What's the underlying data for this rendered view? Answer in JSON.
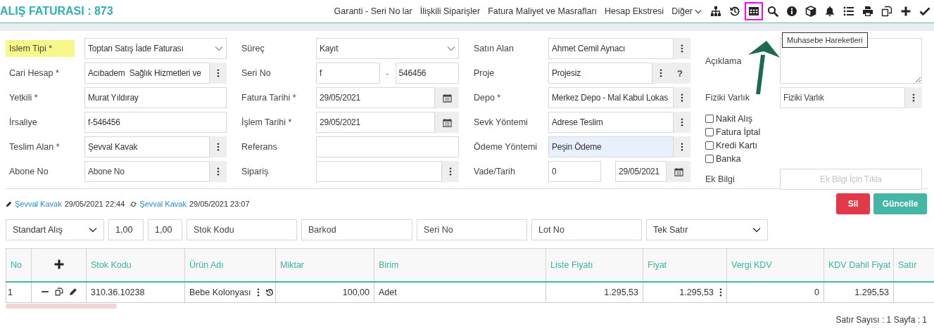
{
  "header": {
    "title": "ALIŞ FATURASI : 873",
    "links": [
      "Garanti - Seri No lar",
      "İlişkili Siparişler",
      "Fatura Maliyet ve Masrafları",
      "Hesap Ekstresi"
    ],
    "more_menu": "Diğer",
    "toolbar": [
      {
        "kind": "sitemap",
        "highlighted": false
      },
      {
        "kind": "history",
        "highlighted": false
      },
      {
        "kind": "table",
        "highlighted": true
      },
      {
        "kind": "search",
        "highlighted": false
      },
      {
        "kind": "info",
        "highlighted": false
      },
      {
        "kind": "cube",
        "highlighted": false
      },
      {
        "kind": "bell",
        "highlighted": false
      },
      {
        "kind": "list",
        "highlighted": false
      },
      {
        "kind": "print",
        "highlighted": false
      },
      {
        "kind": "copy",
        "highlighted": false
      },
      {
        "kind": "plus",
        "highlighted": false
      },
      {
        "kind": "check",
        "highlighted": false
      }
    ],
    "tooltip": "Muhasebe Hareketleri"
  },
  "form": {
    "columns": [
      [
        {
          "label": "Islem Tipi *",
          "kind": "select",
          "value": "Toptan Satış İade Faturası",
          "highlighted": true
        },
        {
          "label": "Cari Hesap *",
          "kind": "picker",
          "value": "Acıbadem  Sağlık Hizmetleri ve",
          "highlighted": false
        },
        {
          "label": "Yetkili *",
          "kind": "text",
          "value": "Murat Yıldıray",
          "highlighted": false
        },
        {
          "label": "İrsaliye",
          "kind": "text",
          "value": "f-546456",
          "highlighted": false
        },
        {
          "label": "Teslim Alan *",
          "kind": "picker",
          "value": "Şevval Kavak",
          "highlighted": false
        },
        {
          "label": "Abone No",
          "kind": "picker",
          "placeholder": "Abone No",
          "highlighted": false
        }
      ],
      [
        {
          "label": "Süreç",
          "kind": "select",
          "value": "Kayıt",
          "highlighted": false
        },
        {
          "label": "Seri No",
          "kind": "split",
          "values": [
            "f",
            "546456"
          ],
          "separator": "-",
          "highlighted": false
        },
        {
          "label": "Fatura Tarihi *",
          "kind": "date",
          "value": "29/05/2021",
          "highlighted": false
        },
        {
          "label": "İşlem Tarihi *",
          "kind": "date",
          "value": "29/05/2021",
          "highlighted": false
        },
        {
          "label": "Referans",
          "kind": "text",
          "highlighted": false
        },
        {
          "label": "Sipariş",
          "kind": "picker",
          "highlighted": false
        }
      ],
      [
        {
          "label": "Satın Alan",
          "kind": "picker",
          "value": "Ahmet Cemil Aynacı",
          "highlighted": false
        },
        {
          "label": "Proje",
          "kind": "picker_help",
          "value": "Projesiz",
          "help": "?",
          "highlighted": false
        },
        {
          "label": "Depo *",
          "kind": "picker",
          "value": "Merkez Depo - Mal Kabul Lokas",
          "highlighted": false
        },
        {
          "label": "Sevk Yöntemi",
          "kind": "picker",
          "value": "Adrese Teslim",
          "highlighted": false
        },
        {
          "label": "Ödeme Yöntemi",
          "kind": "picker",
          "value": "Peşin Ödeme",
          "highlighted": true
        },
        {
          "label": "Vade/Tarih",
          "kind": "split_date",
          "values": [
            "0",
            "29/05/2021"
          ],
          "highlighted": false
        }
      ],
      [
        {
          "label": "Açıklama",
          "kind": "textarea",
          "highlighted": false
        },
        {
          "label": "Fiziki Varlık",
          "kind": "picker",
          "placeholder": "Fiziki Varlık",
          "highlighted": false
        },
        {
          "kind": "checks",
          "items": [
            {
              "label": "Nakit Alış",
              "checked": false
            },
            {
              "label": "Fatura İptal",
              "checked": false
            },
            {
              "label": "Kredi Kartı",
              "checked": false
            },
            {
              "label": "Banka",
              "checked": false
            }
          ]
        },
        {
          "label": "Ek Bilgi",
          "kind": "action",
          "button": "Ek Bilgi İçin Tıkla",
          "highlighted": false
        }
      ]
    ]
  },
  "history": [
    {
      "kind": "edit",
      "user": "Şevval Kavak",
      "time": "29/05/2021 22:44"
    },
    {
      "kind": "update",
      "user": "Şevval Kavak",
      "time": "29/05/2021 23:07"
    }
  ],
  "actions": [
    {
      "label": "Sil",
      "kind": "danger"
    },
    {
      "label": "Güncelle",
      "kind": "primary"
    }
  ],
  "filters": [
    {
      "kind": "select",
      "value": "Standart Alış"
    },
    {
      "kind": "text",
      "value": "1,00"
    },
    {
      "kind": "text",
      "value": "1,00"
    },
    {
      "kind": "text",
      "placeholder": "Stok Kodu"
    },
    {
      "kind": "text",
      "placeholder": "Barkod"
    },
    {
      "kind": "text",
      "placeholder": "Seri No"
    },
    {
      "kind": "text",
      "placeholder": "Lot No"
    },
    {
      "kind": "select",
      "value": "Tek Satır"
    }
  ],
  "table": {
    "columns": [
      {
        "label": "No",
        "kind": "text"
      },
      {
        "kind": "actions"
      },
      {
        "label": "Stok Kodu",
        "kind": "text"
      },
      {
        "label": "Ürün Adı",
        "kind": "product"
      },
      {
        "label": "Miktar",
        "kind": "number"
      },
      {
        "label": "Birim",
        "kind": "text"
      },
      {
        "label": "Liste Fiyatı",
        "kind": "number"
      },
      {
        "label": "Fiyat",
        "kind": "price_menu"
      },
      {
        "label": "Vergi KDV",
        "kind": "number"
      },
      {
        "label": "KDV Dahil Fiyat",
        "kind": "number"
      },
      {
        "label": "Satır",
        "kind": "text"
      }
    ],
    "rows": [
      {
        "cells": [
          "1",
          "",
          "310.36.10238",
          "Bebe Kolonyası",
          "100,00",
          "Adet",
          "1.295,53",
          "1.295,53",
          "0",
          "1.295,53"
        ]
      }
    ]
  },
  "footer": "Satır Sayısı : 1 Sayfa : 1"
}
